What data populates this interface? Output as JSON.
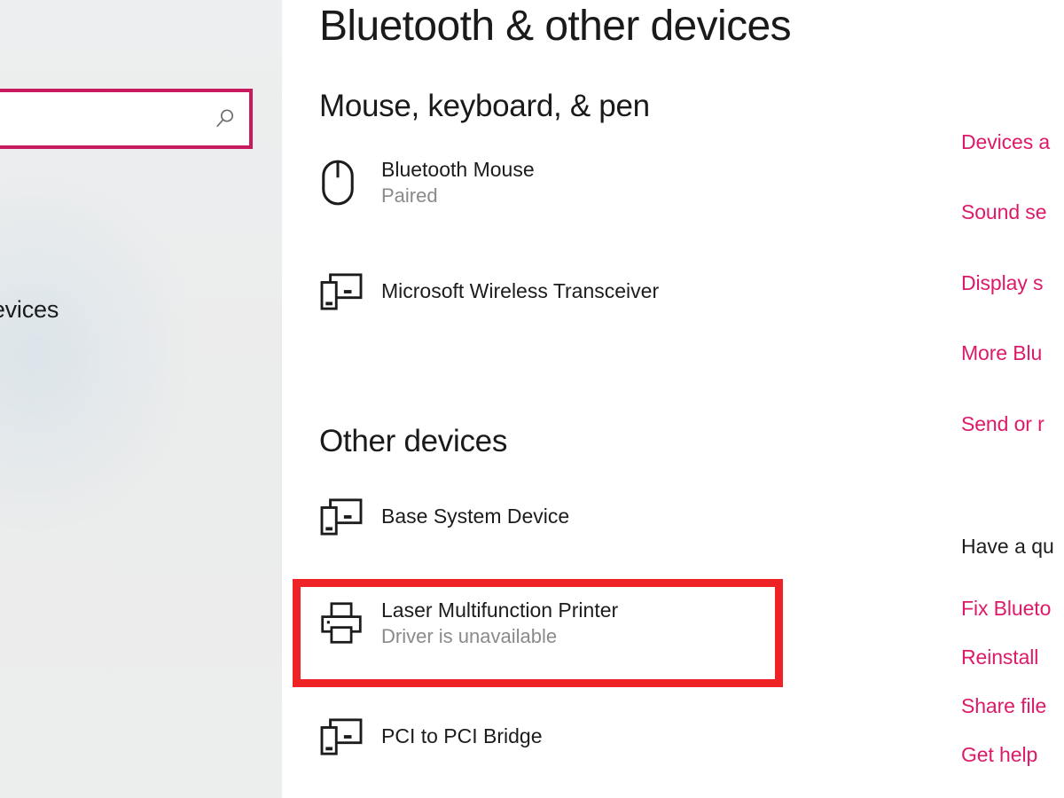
{
  "window": {
    "title": "Bluetooth & other devices"
  },
  "sidebar": {
    "search": {
      "value": "",
      "placeholder": "",
      "icon": "search-icon"
    },
    "partial_nav_label": "devices"
  },
  "main": {
    "page_title": "Bluetooth & other devices",
    "sections": [
      {
        "heading": "Mouse, keyboard, & pen",
        "devices": [
          {
            "name": "Bluetooth Mouse",
            "status": "Paired",
            "icon": "mouse-icon"
          },
          {
            "name": "Microsoft Wireless Transceiver",
            "status": "",
            "icon": "generic-device-icon"
          }
        ]
      },
      {
        "heading": "Other devices",
        "devices": [
          {
            "name": "Base System Device",
            "status": "",
            "icon": "generic-device-icon"
          },
          {
            "name": "Laser Multifunction Printer",
            "status": "Driver is unavailable",
            "icon": "printer-icon"
          },
          {
            "name": "PCI to PCI Bridge",
            "status": "",
            "icon": "generic-device-icon"
          }
        ]
      }
    ]
  },
  "annotation": {
    "highlight_color": "#ef2326",
    "highlight_target": "Laser Multifunction Printer"
  },
  "right_column": {
    "related_links": [
      "Devices a",
      "Sound se",
      "Display s",
      "More Blu",
      "Send or r"
    ],
    "help_heading": "Have a qu",
    "help_links": [
      "Fix Blueto",
      "Reinstall",
      "Share file",
      "Get help"
    ]
  },
  "colors": {
    "accent_pink": "#dd1a6a",
    "search_border": "#c81a5e",
    "annotation_red": "#ef2326",
    "sidebar_bg": "#eceded",
    "status_gray": "#8a8a8a"
  }
}
